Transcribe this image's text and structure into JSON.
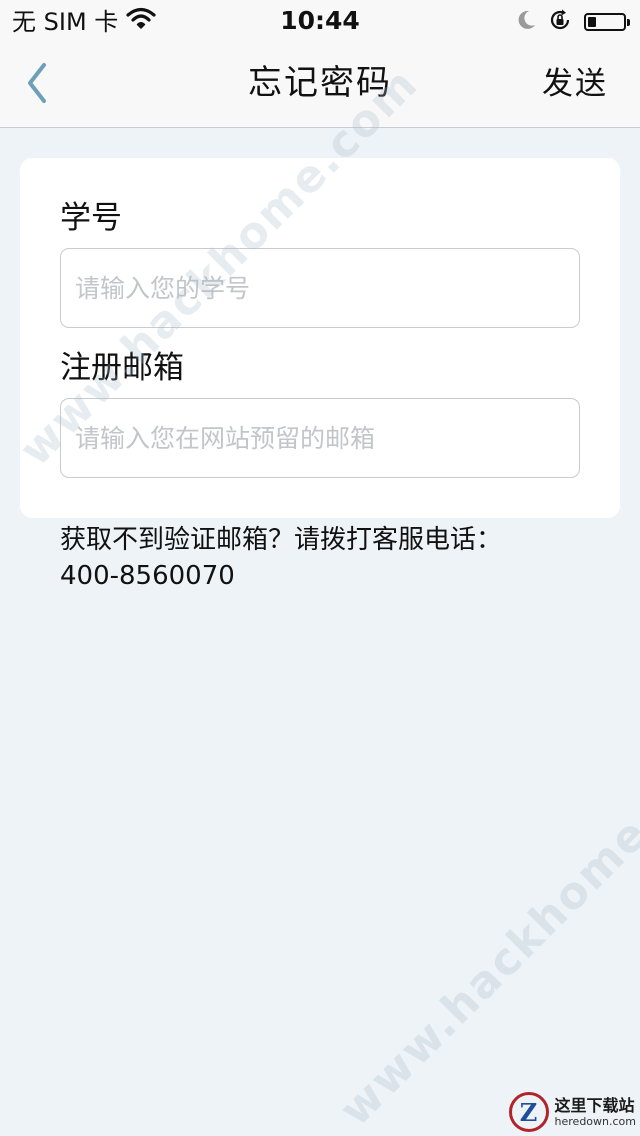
{
  "status_bar": {
    "carrier": "无 SIM 卡",
    "time": "10:44",
    "icons": [
      "wifi-icon",
      "moon-icon",
      "rotation-lock-icon",
      "battery-icon"
    ]
  },
  "nav": {
    "back_icon": "chevron-left-icon",
    "title": "忘记密码",
    "send_label": "发送"
  },
  "form": {
    "student_id": {
      "label": "学号",
      "placeholder": "请输入您的学号",
      "value": ""
    },
    "email": {
      "label": "注册邮箱",
      "placeholder": "请输入您在网站预留的邮箱",
      "value": ""
    }
  },
  "help": {
    "text": "获取不到验证邮箱？请拨打客服电话：",
    "phone": "400-8560070"
  },
  "watermark": {
    "text": "www.hackhome.com"
  },
  "logo": {
    "name": "这里下载站",
    "url_text": "heredown.com"
  },
  "colors": {
    "background": "#eef3f7",
    "nav_background": "#f8f8f9",
    "accent": "#6d9fba",
    "placeholder": "#c2c5ca"
  }
}
